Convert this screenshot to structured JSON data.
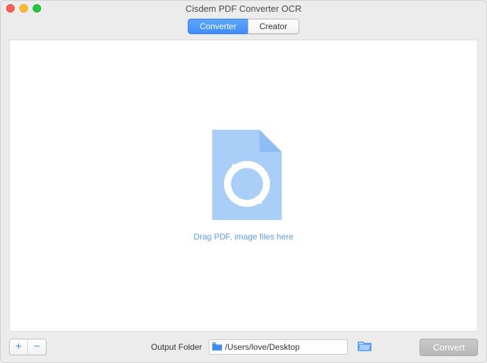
{
  "window": {
    "title": "Cisdem PDF Converter OCR"
  },
  "tabs": {
    "converter": "Converter",
    "creator": "Creator",
    "active": "converter"
  },
  "dropzone": {
    "hint": "Drag PDF, image files here"
  },
  "footer": {
    "output_label": "Output Folder",
    "output_path": "/Users/love/Desktop",
    "convert_label": "Convert"
  },
  "icons": {
    "add": "+",
    "remove": "−",
    "folder": "📁"
  }
}
